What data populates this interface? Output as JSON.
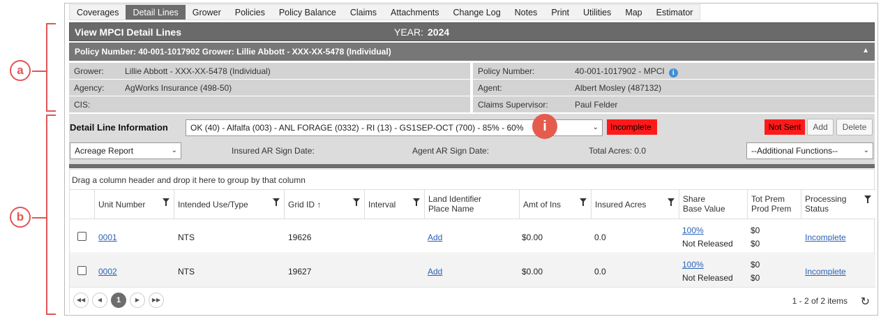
{
  "annotations": {
    "a": "a",
    "b": "b"
  },
  "tabs": [
    "Coverages",
    "Detail Lines",
    "Grower",
    "Policies",
    "Policy Balance",
    "Claims",
    "Attachments",
    "Change Log",
    "Notes",
    "Print",
    "Utilities",
    "Map",
    "Estimator"
  ],
  "active_tab": "Detail Lines",
  "title": "View MPCI Detail Lines",
  "year_label": "YEAR:",
  "year_value": "2024",
  "policy_bar": "Policy Number: 40-001-1017902 Grower: Lillie Abbott - XXX-XX-5478 (Individual)",
  "info": {
    "grower_label": "Grower:",
    "grower_value": "Lillie Abbott - XXX-XX-5478 (Individual)",
    "policy_label": "Policy Number:",
    "policy_value": "40-001-1017902 - MPCI",
    "agency_label": "Agency:",
    "agency_value": "AgWorks Insurance (498-50)",
    "agent_label": "Agent:",
    "agent_value": "Albert Mosley (487132)",
    "cis_label": "CIS:",
    "cis_value": "",
    "supervisor_label": "Claims Supervisor:",
    "supervisor_value": "Paul Felder"
  },
  "detail": {
    "header": "Detail Line Information",
    "line_select": "OK (40) - Alfalfa (003) - ANL FORAGE (0332) - RI (13) - GS1SEP-OCT (700) - 85% - 60%",
    "status": "Incomplete",
    "not_sent": "Not Sent",
    "add": "Add",
    "delete": "Delete",
    "report_select": "Acreage Report",
    "insured_sign": "Insured AR Sign Date:",
    "agent_sign": "Agent AR Sign Date:",
    "total_acres": "Total Acres: 0.0",
    "functions_select": "--Additional Functions--",
    "info_marker": "i"
  },
  "grid": {
    "group_hint": "Drag a column header and drop it here to group by that column",
    "columns": {
      "unit": "Unit Number",
      "use": "Intended Use/Type",
      "grid": "Grid ID",
      "interval": "Interval",
      "land1": "Land Identifier",
      "land2": "Place Name",
      "amt": "Amt of Ins",
      "acres": "Insured Acres",
      "share1": "Share",
      "share2": "Base Value",
      "prem1": "Tot Prem",
      "prem2": "Prod Prem",
      "proc1": "Processing",
      "proc2": "Status"
    },
    "rows": [
      {
        "unit": "0001",
        "use": "NTS",
        "grid": "19626",
        "interval": "",
        "land": "Add",
        "amt": "$0.00",
        "acres": "0.0",
        "share": "100%",
        "base": "Not Released",
        "tot": "$0",
        "prod": "$0",
        "status": "Incomplete"
      },
      {
        "unit": "0002",
        "use": "NTS",
        "grid": "19627",
        "interval": "",
        "land": "Add",
        "amt": "$0.00",
        "acres": "0.0",
        "share": "100%",
        "base": "Not Released",
        "tot": "$0",
        "prod": "$0",
        "status": "Incomplete"
      }
    ],
    "page": "1",
    "page_info": "1 - 2 of 2 items"
  }
}
